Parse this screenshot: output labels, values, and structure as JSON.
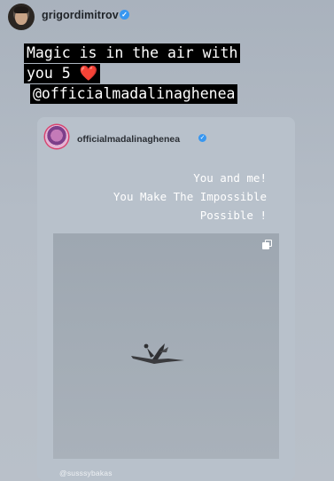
{
  "header": {
    "username": "grigordimitrov",
    "verified_glyph": "✓"
  },
  "caption": {
    "line1": "Magic is in the air with",
    "line2": "you 5 ",
    "heart": "❤️",
    "line3": "@officialmadalinaghenea"
  },
  "shared_post": {
    "username": "officialmadalinaghenea",
    "verified_glyph": "✓",
    "text_line1": "You and me!",
    "text_line2": "You Make The Impossible",
    "text_line3": "Possible !",
    "photo_credit": "@susssybakas"
  },
  "icons": {
    "verified": "verified-badge-icon",
    "multi": "multiple-photos-icon"
  }
}
